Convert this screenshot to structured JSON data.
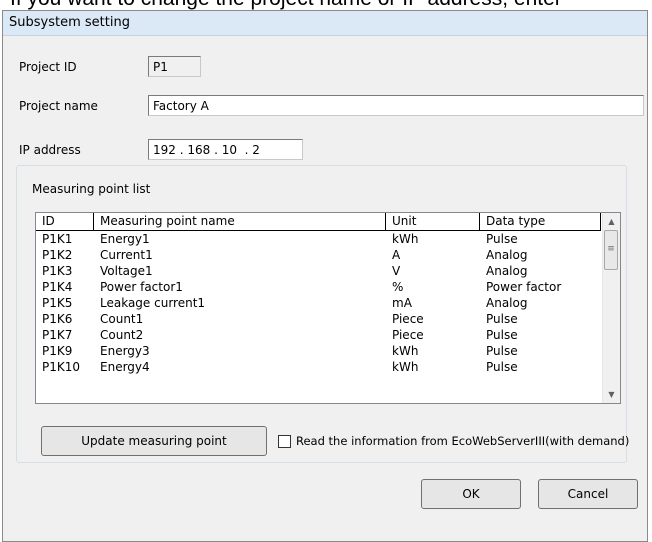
{
  "doc_text": "If you want to change the project name or IP address, enter",
  "window": {
    "title": "Subsystem setting"
  },
  "project_id": {
    "label": "Project ID",
    "value": "P1"
  },
  "project_name": {
    "label": "Project name",
    "value": "Factory A"
  },
  "ip_address": {
    "label": "IP address",
    "value": "192 . 168 . 10  . 2"
  },
  "measuring_point_list": {
    "label": "Measuring point list",
    "columns": {
      "id": "ID",
      "name": "Measuring point name",
      "unit": "Unit",
      "type": "Data type"
    },
    "rows": [
      {
        "id": "P1K1",
        "name": "Energy1",
        "unit": "kWh",
        "type": "Pulse"
      },
      {
        "id": "P1K2",
        "name": "Current1",
        "unit": "A",
        "type": "Analog"
      },
      {
        "id": "P1K3",
        "name": "Voltage1",
        "unit": "V",
        "type": "Analog"
      },
      {
        "id": "P1K4",
        "name": "Power factor1",
        "unit": "%",
        "type": "Power factor"
      },
      {
        "id": "P1K5",
        "name": "Leakage current1",
        "unit": "mA",
        "type": "Analog"
      },
      {
        "id": "P1K6",
        "name": "Count1",
        "unit": "Piece",
        "type": "Pulse"
      },
      {
        "id": "P1K7",
        "name": "Count2",
        "unit": "Piece",
        "type": "Pulse"
      },
      {
        "id": "P1K9",
        "name": "Energy3",
        "unit": "kWh",
        "type": "Pulse"
      },
      {
        "id": "P1K10",
        "name": "Energy4",
        "unit": "kWh",
        "type": "Pulse"
      }
    ]
  },
  "update_button": "Update measuring point",
  "read_checkbox": {
    "label": "Read the information from EcoWebServerIII(with demand)",
    "checked": false
  },
  "ok_button": "OK",
  "cancel_button": "Cancel"
}
